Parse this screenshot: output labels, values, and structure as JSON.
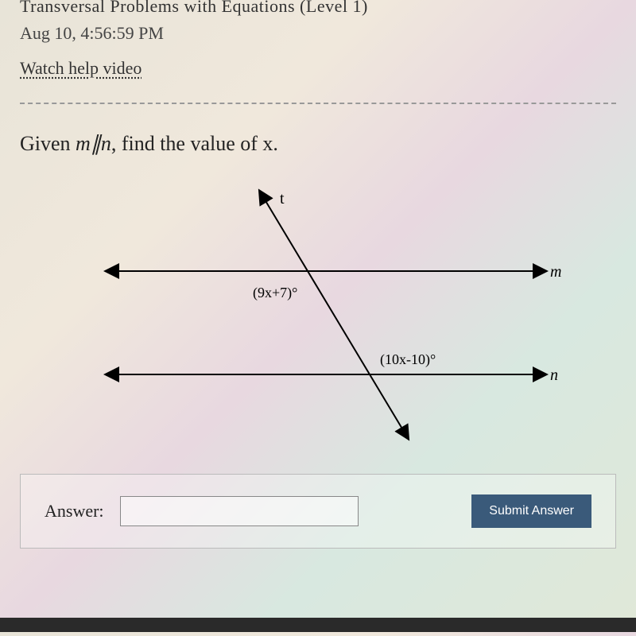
{
  "header": {
    "partial_title": "Transversal Problems with Equations (Level 1)",
    "timestamp": "Aug 10, 4:56:59 PM",
    "help_link": "Watch help video"
  },
  "question": {
    "prefix": "Given ",
    "math": "m∥n",
    "suffix": ", find the value of x."
  },
  "diagram": {
    "transversal_label": "t",
    "line1_label": "m",
    "line2_label": "n",
    "angle1": "(9x+7)°",
    "angle2": "(10x-10)°"
  },
  "answer": {
    "label": "Answer:",
    "submit_label": "Submit Answer"
  }
}
